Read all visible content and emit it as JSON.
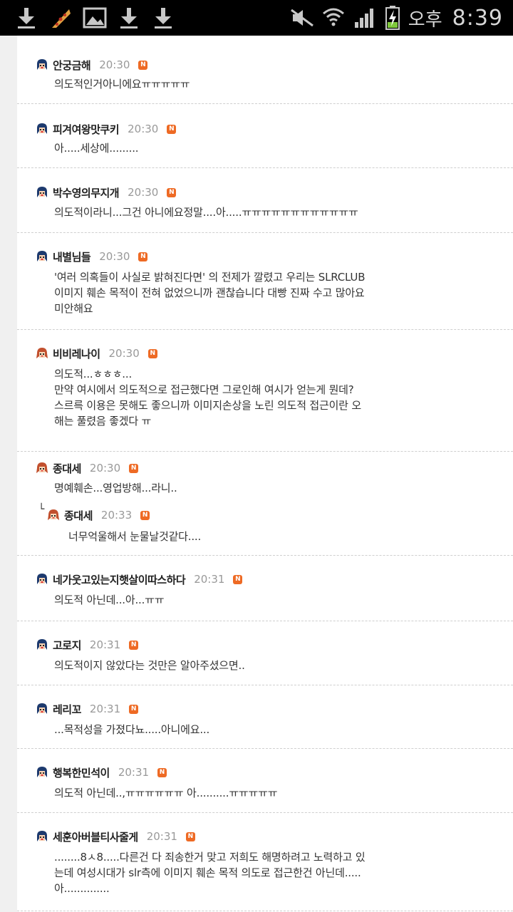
{
  "status_bar": {
    "ampm": "오후",
    "time": "8:39",
    "left_icons": [
      "download-icon",
      "pizza-icon",
      "image-icon",
      "download-icon",
      "download-icon"
    ],
    "right_icons": [
      "mute-icon",
      "wifi-icon",
      "signal-icon",
      "battery-charging-icon"
    ]
  },
  "comments": [
    {
      "author": "안궁금해",
      "time": "20:30",
      "badge": "N",
      "text": "의도적인거아니에요ㅠㅠㅠㅠㅠ"
    },
    {
      "author": "피겨여왕맛쿠키",
      "time": "20:30",
      "badge": "N",
      "text": "아.....세상에........."
    },
    {
      "author": "박수영의무지개",
      "time": "20:30",
      "badge": "N",
      "text": "의도적이라니...그건 아니에요정말....아.....ㅠㅠㅠㅠㅠㅠㅠㅠㅠㅠㅠㅠ"
    },
    {
      "author": "내별님들",
      "time": "20:30",
      "badge": "N",
      "lines": [
        "'여러 의혹들이 사실로 밝혀진다면' 의 전제가 깔렸고 우리는 SLRCLUB",
        "이미지 훼손 목적이 전혀 없었으니까 괜찮습니다 대빵 진짜 수고 많아요",
        "미안해요"
      ]
    },
    {
      "author": "비비레나이",
      "time": "20:30",
      "badge": "N",
      "lines": [
        "의도적...ㅎㅎㅎ...",
        "만약 여시에서 의도적으로 접근했다면 그로인해 여시가 얻는게 뭔데?",
        "스르륵 이용은 못해도 좋으니까 이미지손상을 노린 의도적 접근이란 오",
        "해는 풀렸음 좋겠다 ㅠ"
      ]
    },
    {
      "author": "종대세",
      "time": "20:30",
      "badge": "N",
      "text": "명예훼손...영업방해...라니..",
      "reply": {
        "author": "종대세",
        "time": "20:33",
        "badge": "N",
        "text": "너무억울해서 눈물날것같다...."
      }
    },
    {
      "author": "네가웃고있는지햇살이따스하다",
      "time": "20:31",
      "badge": "N",
      "text": "의도적 아닌데...아...ㅠㅠ"
    },
    {
      "author": "고로지",
      "time": "20:31",
      "badge": "N",
      "text": "의도적이지 않았다는 것만은 알아주셨으면.."
    },
    {
      "author": "레리꼬",
      "time": "20:31",
      "badge": "N",
      "text": "...목적성을 가졌다뇨.....아니에요..."
    },
    {
      "author": "행복한민석이",
      "time": "20:31",
      "badge": "N",
      "text": "의도적 아닌데..,ㅠㅠㅠㅠㅠㅠ 아..........ㅠㅠㅠㅠㅠ"
    },
    {
      "author": "세훈아버블티사줄게",
      "time": "20:31",
      "badge": "N",
      "lines": [
        "........8ㅅ8.....다른건 다 죄송한거 맞고 저희도 해명하려고 노력하고 있",
        "는데 여성시대가 slr측에 이미지 훼손 목적 의도로 접근한건 아닌데.....",
        "아.............."
      ]
    }
  ],
  "colors": {
    "badge": "#ee6a24",
    "time": "#999999",
    "statusbar": "#000000"
  }
}
